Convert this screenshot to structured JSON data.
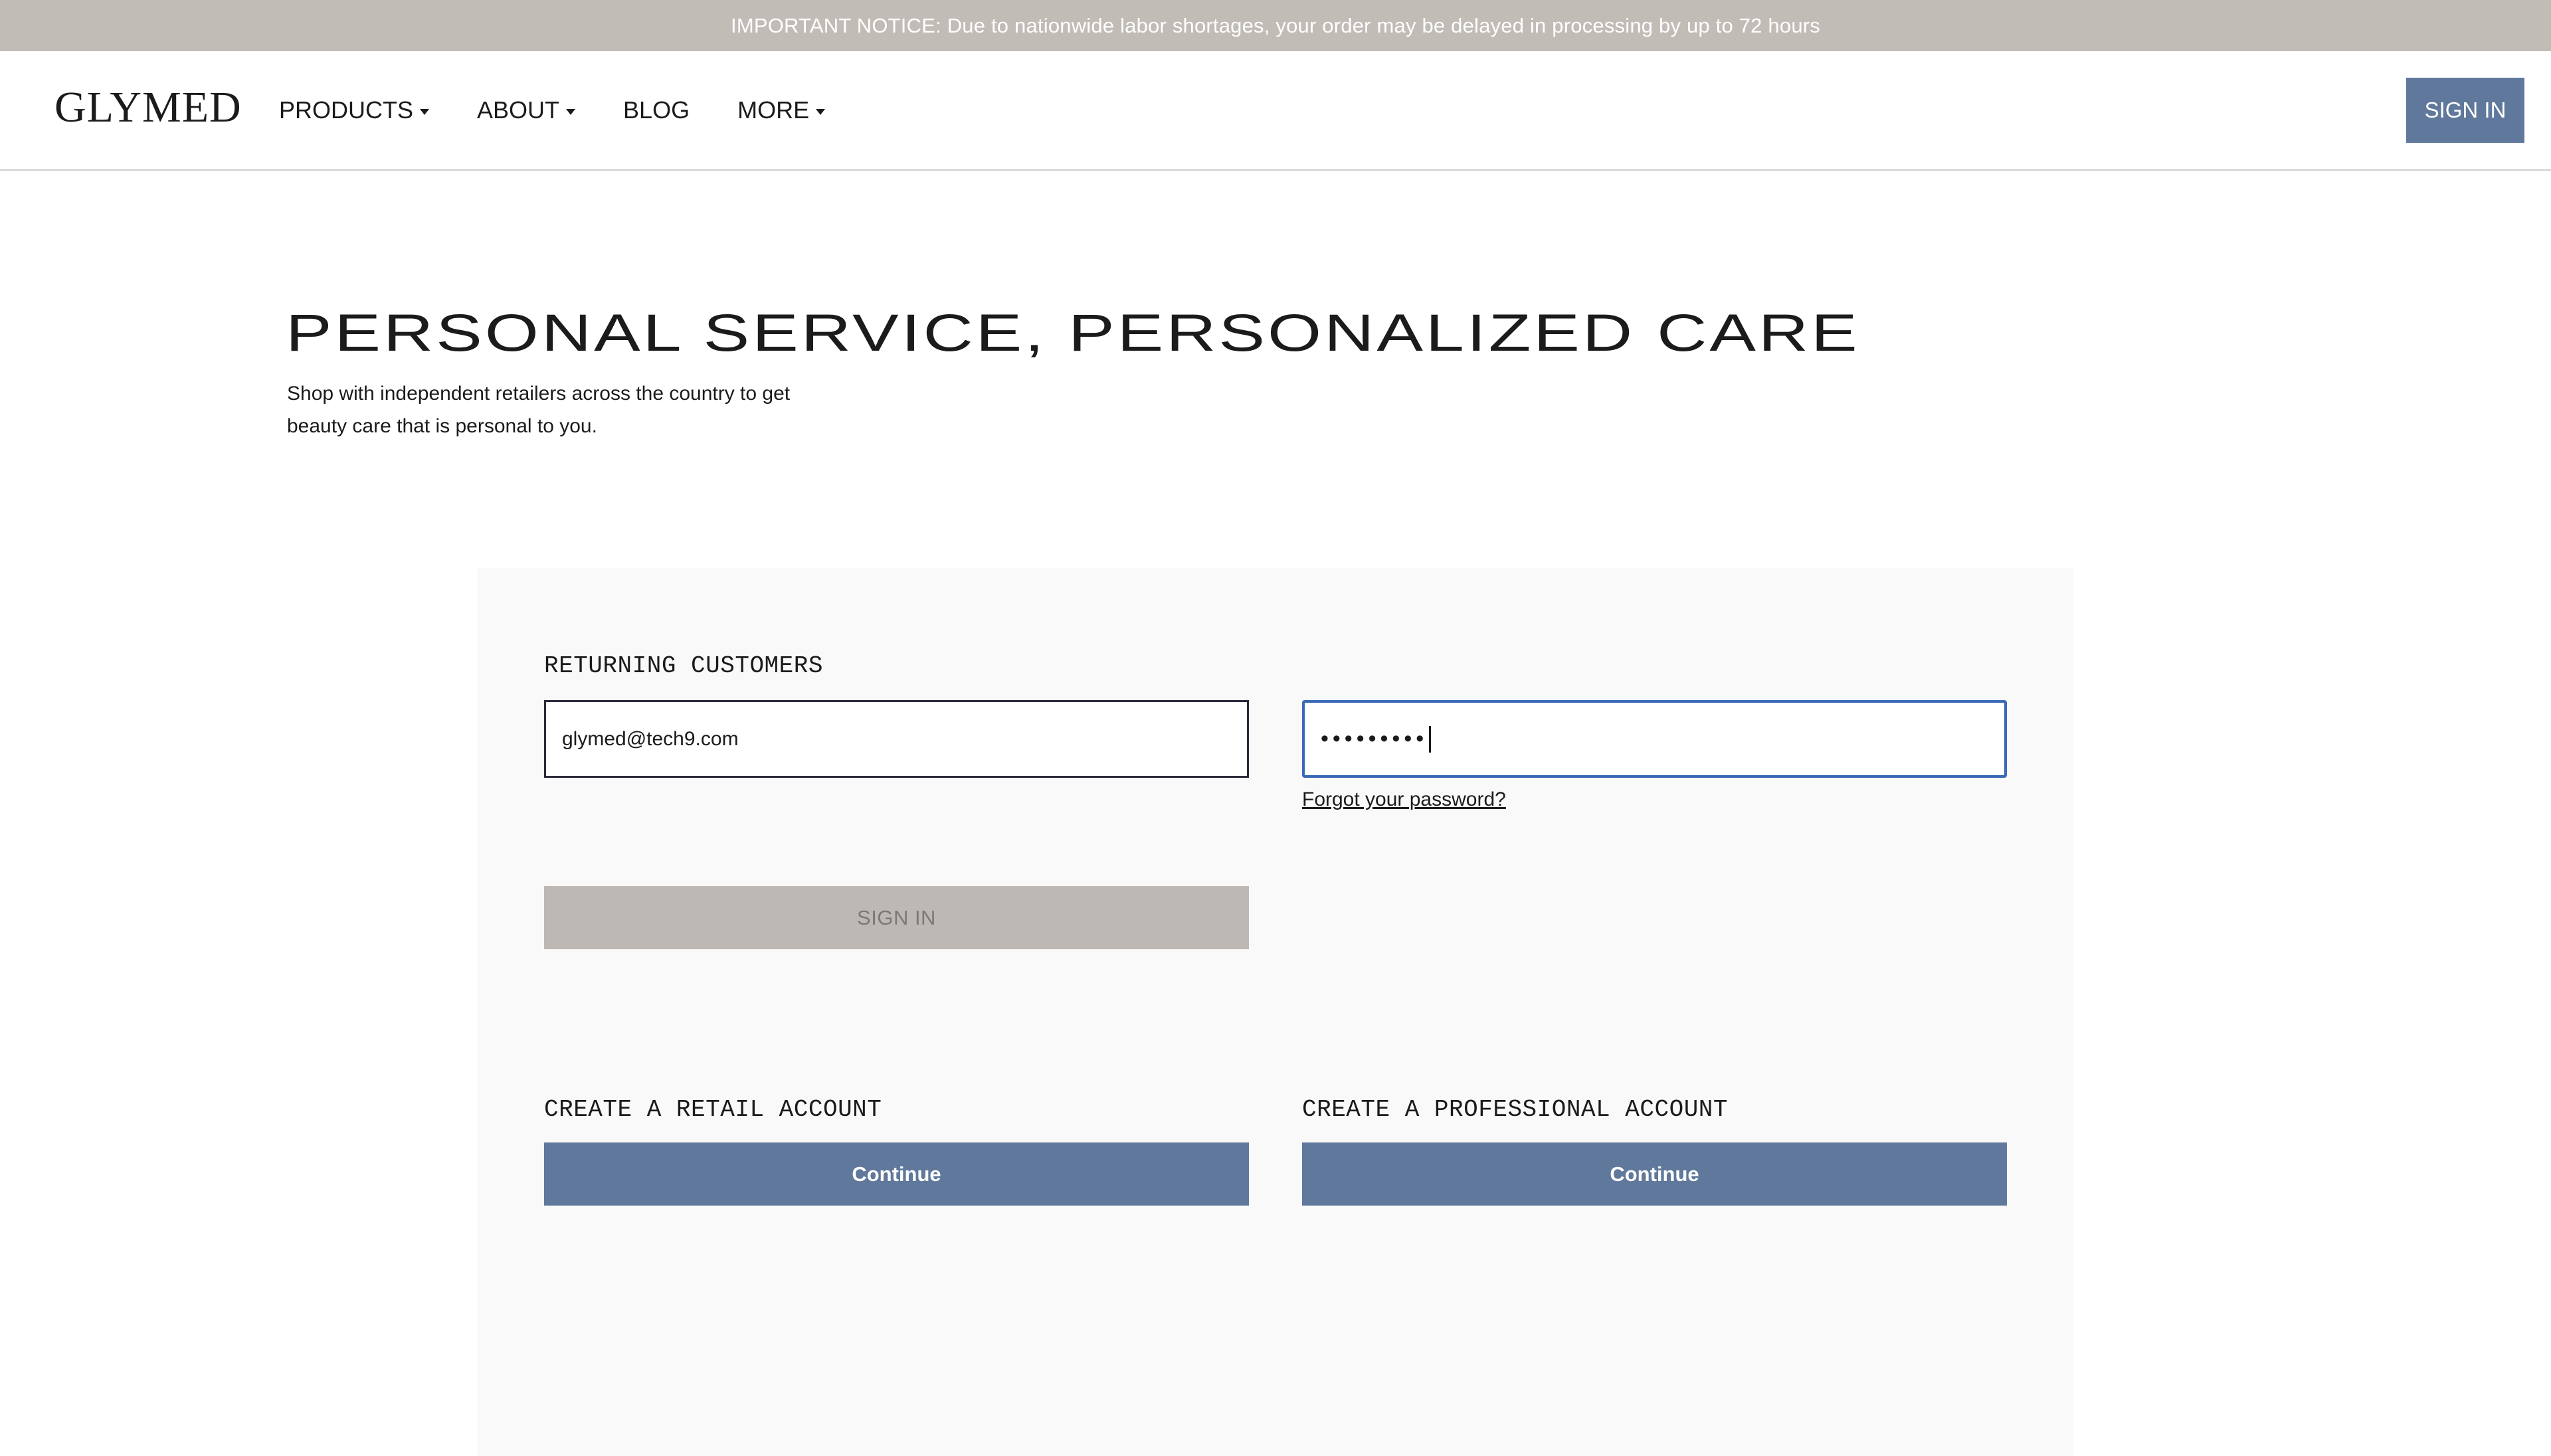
{
  "notice": {
    "text": "IMPORTANT NOTICE: Due to nationwide labor shortages, your order may be delayed in processing by up to 72 hours"
  },
  "header": {
    "logo": "GLYMED",
    "nav": [
      {
        "label": "PRODUCTS",
        "dropdown": true
      },
      {
        "label": "ABOUT",
        "dropdown": true
      },
      {
        "label": "BLOG",
        "dropdown": false
      },
      {
        "label": "MORE",
        "dropdown": true
      }
    ],
    "signin_label": "SIGN IN"
  },
  "hero": {
    "title": "PERSONAL SERVICE, PERSONALIZED CARE",
    "subtitle": "Shop with independent retailers across the country to get beauty care that is personal to you."
  },
  "login": {
    "heading": "RETURNING CUSTOMERS",
    "email_value": "glymed@tech9.com",
    "password_mask": "•••••••••",
    "forgot_label": "Forgot your password?",
    "signin_label": "SIGN IN"
  },
  "create": {
    "retail": {
      "heading": "CREATE A RETAIL ACCOUNT",
      "button_label": "Continue"
    },
    "professional": {
      "heading": "CREATE A PROFESSIONAL ACCOUNT",
      "button_label": "Continue"
    }
  },
  "colors": {
    "accent": "#5f789b",
    "notice_bg": "#c2bcb7",
    "disabled_button": "#bdb8b4",
    "focus_border": "#3b69b8"
  }
}
